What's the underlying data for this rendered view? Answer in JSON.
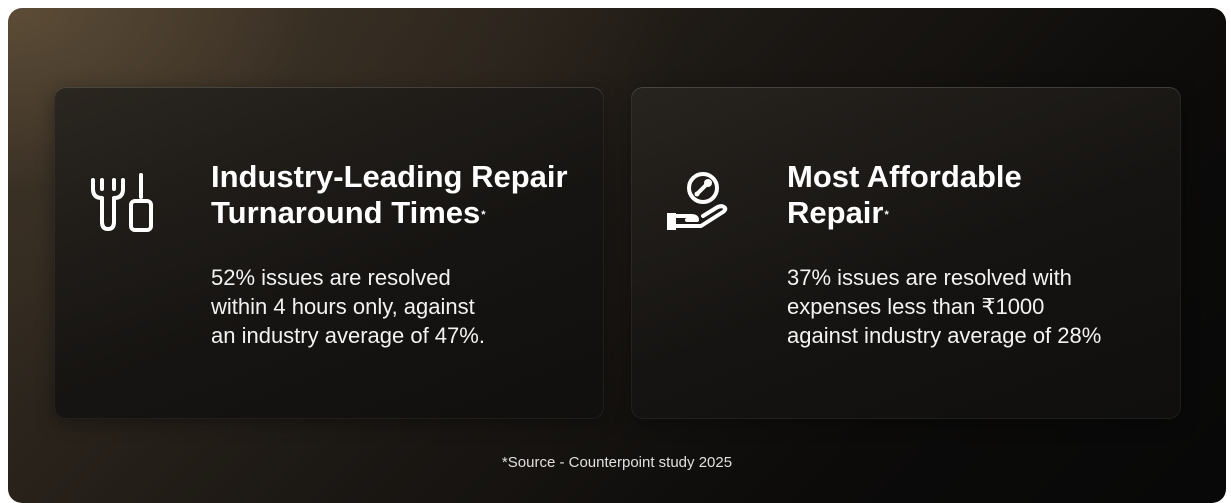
{
  "cards": [
    {
      "icon": "tools-icon",
      "title_lines": [
        "Industry-Leading Repair",
        "Turnaround Times"
      ],
      "title_mark": "*",
      "desc_lines": [
        "52% issues are resolved",
        "within 4 hours only, against",
        "an industry average of 47%."
      ]
    },
    {
      "icon": "hand-wrench-icon",
      "title_lines": [
        "Most Affordable",
        "Repair"
      ],
      "title_mark": "*",
      "desc_lines": [
        "37% issues are resolved with",
        "expenses less than ₹1000",
        "against industry average of 28%"
      ]
    }
  ],
  "footnote": "*Source - Counterpoint study 2025",
  "colors": {
    "text": "#ffffff",
    "background_dark": "#0c0b0a",
    "background_warm": "#5c4c37"
  }
}
